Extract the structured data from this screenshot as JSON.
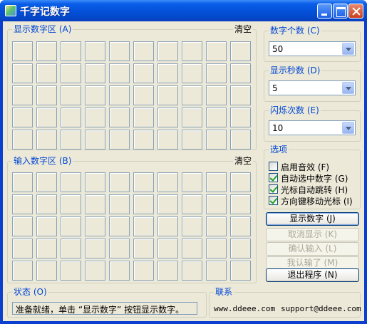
{
  "window": {
    "title": "千字记数字"
  },
  "display_area": {
    "title": "显示数字区 (A)",
    "clear_label": "清空",
    "rows": 5,
    "cols": 10
  },
  "input_area": {
    "title": "输入数字区 (B)",
    "clear_label": "清空",
    "rows": 5,
    "cols": 10
  },
  "digit_count": {
    "title": "数字个数 (C)",
    "value": "50"
  },
  "display_seconds": {
    "title": "显示秒数 (D)",
    "value": "5"
  },
  "blink_count": {
    "title": "闪烁次数 (E)",
    "value": "10"
  },
  "options": {
    "title": "选项",
    "items": [
      {
        "label": "启用音效 (F)",
        "checked": false
      },
      {
        "label": "自动选中数字 (G)",
        "checked": true
      },
      {
        "label": "光标自动跳转 (H)",
        "checked": true
      },
      {
        "label": "方向键移动光标 (I)",
        "checked": true
      }
    ]
  },
  "buttons": {
    "show": "显示数字 (J)",
    "cancel": "取消显示 (K)",
    "confirm": "确认输入 (L)",
    "done": "我认输了 (M)",
    "exit": "退出程序 (N)"
  },
  "status": {
    "title": "状态 (O)",
    "text": "准备就绪，单击 “显示数字” 按钮显示数字。"
  },
  "contact": {
    "title": "联系",
    "website": "www.ddeee.com",
    "email": "support@ddeee.com"
  }
}
